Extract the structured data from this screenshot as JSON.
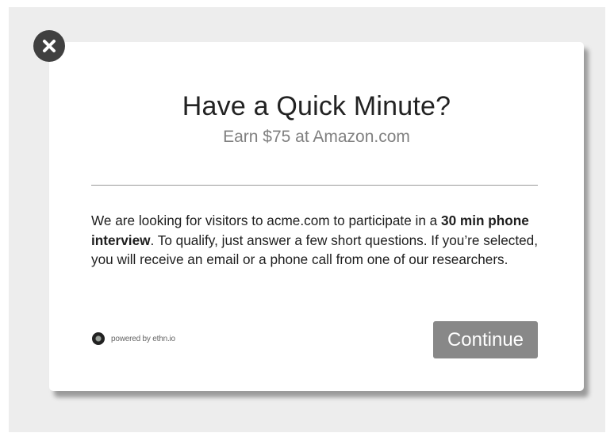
{
  "dialog": {
    "title": "Have a Quick Minute?",
    "subtitle": "Earn $75 at Amazon.com",
    "body": {
      "part1": "We are looking for visitors to acme.com to participate in a ",
      "bold": "30 min phone interview",
      "part2": ". To qualify, just answer a few short questions. If you’re selected, you will receive an email or a phone call from one of our researchers."
    },
    "powered_by": "powered by ethn.io",
    "continue_label": "Continue"
  },
  "icons": {
    "close": "close-icon",
    "logo": "ethnio-logo-icon"
  },
  "colors": {
    "close_bg": "#404040",
    "button_bg": "#888888",
    "backdrop": "#ededed",
    "subtitle": "#808080"
  }
}
